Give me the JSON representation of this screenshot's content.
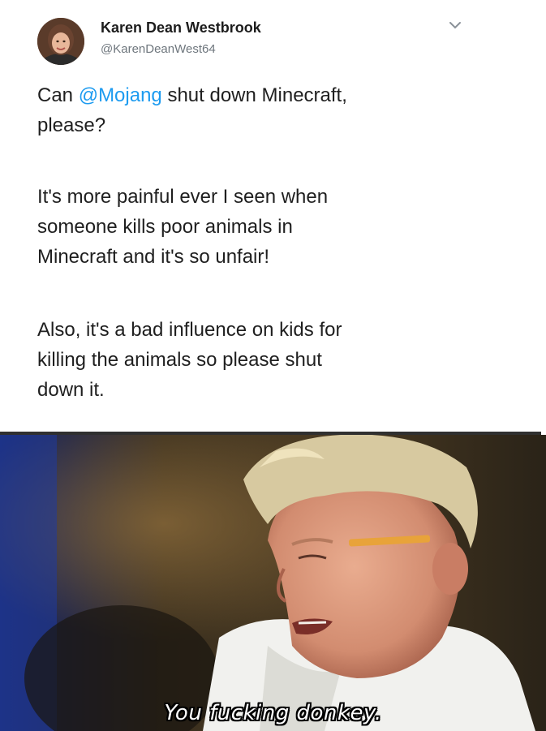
{
  "tweet": {
    "author_name": "Karen Dean Westbrook",
    "author_handle": "@KarenDeanWest64",
    "paragraph1": {
      "line1_before": "Can ",
      "mention": "@Mojang",
      "line1_after": " shut down Minecraft,",
      "line2": "please?"
    },
    "paragraph2": {
      "line1": "It's more painful ever I seen when",
      "line2": "someone kills poor animals in",
      "line3": "Minecraft and it's so unfair!"
    },
    "paragraph3": {
      "line1": "Also, it's a bad influence on kids for",
      "line2": "killing the animals so please shut",
      "line3": "down it."
    },
    "mention_color": "#1d9bf0"
  },
  "meme": {
    "caption": "You fucking donkey."
  },
  "icons": {
    "menu": "chevron-down-icon",
    "avatar": "avatar"
  }
}
